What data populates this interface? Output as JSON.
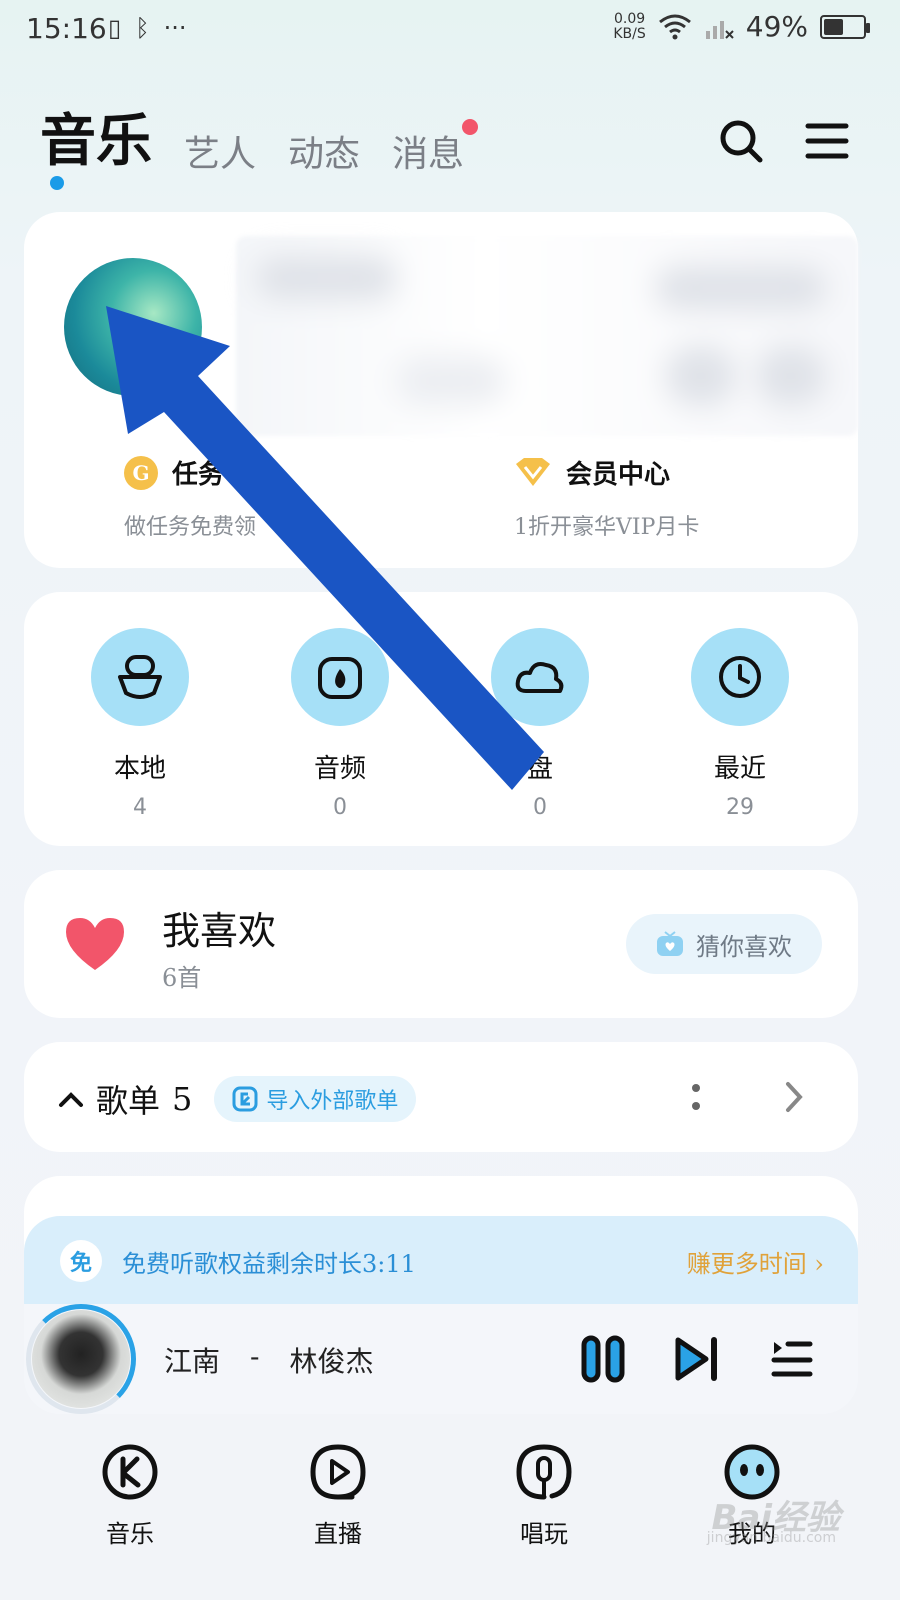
{
  "status": {
    "time": "15:16",
    "net_speed": "0.09",
    "net_unit": "KB/S",
    "battery_pct": "49%",
    "battery_level": 0.49
  },
  "header": {
    "tabs": [
      {
        "label": "音乐",
        "active": true
      },
      {
        "label": "艺人",
        "active": false
      },
      {
        "label": "动态",
        "active": false
      },
      {
        "label": "消息",
        "active": false,
        "badge": true
      }
    ],
    "icons": [
      "search-icon",
      "menu-icon"
    ]
  },
  "profile": {
    "services": [
      {
        "title": "任务",
        "subtitle": "做任务免费领",
        "icon": "gold-coin-icon"
      },
      {
        "title": "会员中心",
        "subtitle": "1折开豪华VIP月卡",
        "icon": "vip-diamond-icon"
      }
    ]
  },
  "shortcuts": [
    {
      "label": "本地",
      "count": "4",
      "icon": "local-icon"
    },
    {
      "label": "音频",
      "count": "0",
      "icon": "audio-icon"
    },
    {
      "label": "盘",
      "count": "0",
      "icon": "cloud-icon"
    },
    {
      "label": "最近",
      "count": "29",
      "icon": "clock-icon"
    }
  ],
  "favorites": {
    "title": "我喜欢",
    "count": "6首",
    "guess_label": "猜你喜欢"
  },
  "playlists": {
    "title": "歌单",
    "count": "5",
    "import_label": "导入外部歌单"
  },
  "promo": {
    "badge": "免",
    "text": "免费听歌权益剩余时长3:11",
    "link": "赚更多时间"
  },
  "player": {
    "song": "江南",
    "separator": "-",
    "artist": "林俊杰"
  },
  "bottom_nav": [
    {
      "label": "音乐",
      "icon": "k-music-icon"
    },
    {
      "label": "直播",
      "icon": "live-icon"
    },
    {
      "label": "唱玩",
      "icon": "mic-icon"
    },
    {
      "label": "我的",
      "icon": "my-icon"
    }
  ],
  "watermark": {
    "main": "Bai经验",
    "sub": "jingyan.baidu.com"
  },
  "colors": {
    "accent": "#2b9de0",
    "arrow": "#1a55c4",
    "heart": "#f2556a",
    "gold": "#f5c04a"
  }
}
